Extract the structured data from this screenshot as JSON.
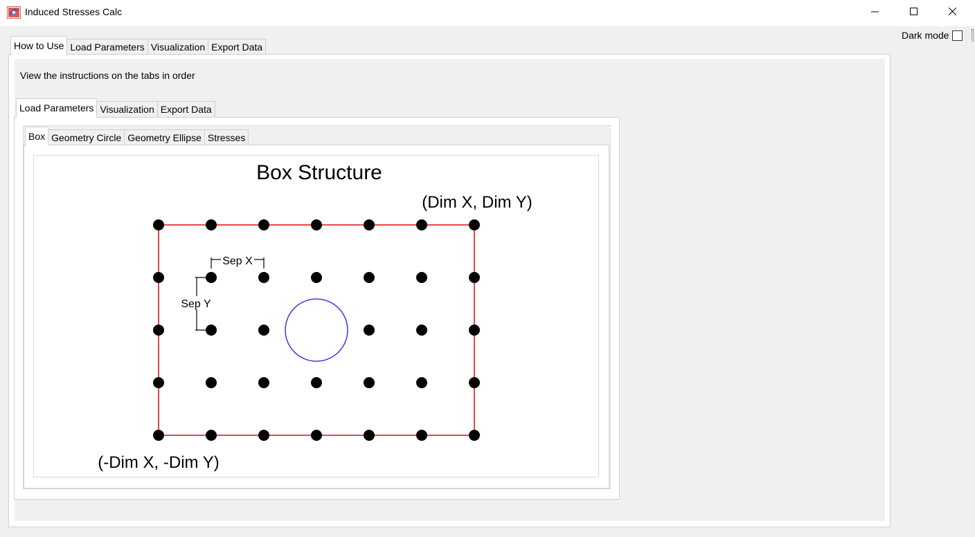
{
  "window": {
    "title": "Induced Stresses Calc",
    "minimize_glyph": "—",
    "maximize_glyph": "☐",
    "close_glyph": "✕"
  },
  "dark_mode": {
    "label": "Dark mode",
    "checked": false
  },
  "main_tabs": [
    "How to Use",
    "Load Parameters",
    "Visualization",
    "Export Data"
  ],
  "main_active": "How to Use",
  "instructions": "View the instructions on the tabs in order",
  "howto_tabs": [
    "Load Parameters",
    "Visualization",
    "Export Data"
  ],
  "howto_active": "Load Parameters",
  "load_tabs": [
    "Box",
    "Geometry Circle",
    "Geometry Ellipse",
    "Stresses"
  ],
  "load_active": "Box",
  "figure": {
    "title": "Box Structure",
    "top_right_label": "(Dim X, Dim Y)",
    "bottom_left_label": "(-Dim X, -Dim Y)",
    "sep_x_label": "Sep X",
    "sep_y_label": "Sep Y",
    "grid_columns": 7,
    "grid_rows": 5,
    "box_color": "#e8484a",
    "circle_color": "#3b3bea",
    "node_color": "#000000"
  }
}
